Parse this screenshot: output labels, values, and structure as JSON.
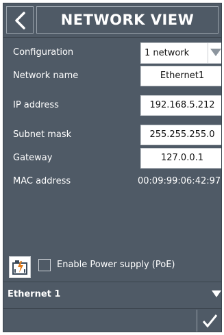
{
  "header": {
    "title": "NETWORK VIEW"
  },
  "form": {
    "configuration": {
      "label": "Configuration",
      "value": "1 network"
    },
    "network_name": {
      "label": "Network name",
      "value": "Ethernet1"
    },
    "ip_address": {
      "label": "IP address",
      "value": "192.168.5.212"
    },
    "subnet_mask": {
      "label": "Subnet mask",
      "value": "255.255.255.0"
    },
    "gateway": {
      "label": "Gateway",
      "value": "127.0.0.1"
    },
    "mac_address": {
      "label": "MAC address",
      "value": "00:09:99:06:42:97"
    }
  },
  "poe": {
    "label": "Enable Power supply (PoE)",
    "checked": false
  },
  "footer": {
    "interface": "Ethernet 1"
  },
  "colors": {
    "background": "#4f5a66",
    "text": "#ffffff",
    "field_bg": "#ffffff"
  },
  "icons": {
    "back": "chevron-left-icon",
    "dropdown": "triangle-down-icon",
    "poe": "power-supply-icon",
    "interface_expand": "triangle-down-icon",
    "confirm": "checkmark-icon"
  }
}
